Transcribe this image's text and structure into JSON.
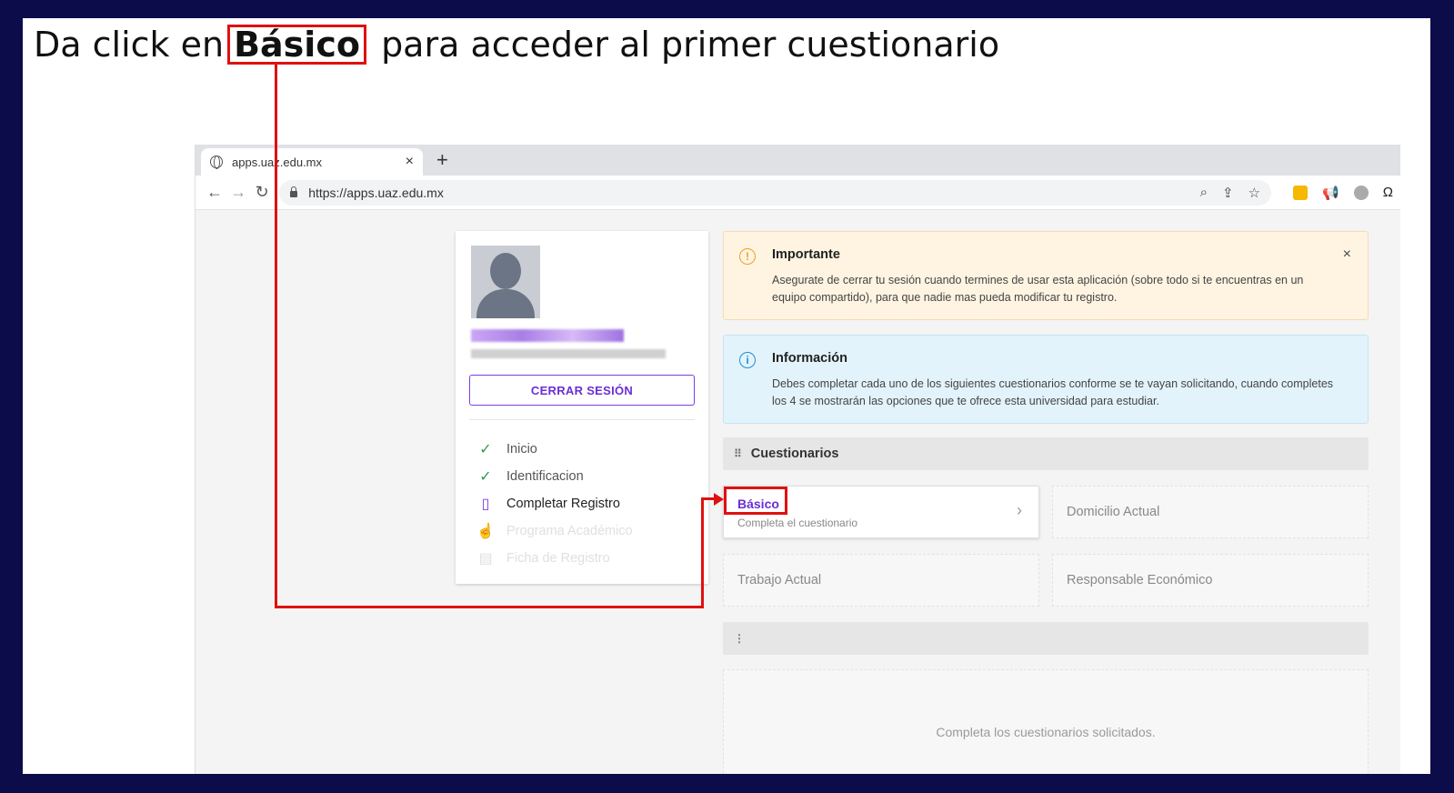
{
  "instruction": {
    "before": "Da click en",
    "highlight": "Básico",
    "after": "para acceder al primer cuestionario"
  },
  "browser": {
    "tab_title": "apps.uaz.edu.mx",
    "tab_close": "×",
    "new_tab": "+",
    "url": "https://apps.uaz.edu.mx",
    "nav": {
      "back": "←",
      "forward": "→",
      "reload": "↻"
    }
  },
  "profile": {
    "logout_label": "CERRAR SESIÓN",
    "steps": [
      {
        "label": "Inicio",
        "icon": "check-icon",
        "state": "done"
      },
      {
        "label": "Identificacion",
        "icon": "check-icon",
        "state": "done"
      },
      {
        "label": "Completar Registro",
        "icon": "book-icon",
        "state": "current"
      },
      {
        "label": "Programa Académico",
        "icon": "hand-icon",
        "state": "disabled"
      },
      {
        "label": "Ficha de Registro",
        "icon": "document-icon",
        "state": "disabled"
      }
    ]
  },
  "alerts": {
    "important": {
      "title": "Importante",
      "text": "Asegurate de cerrar tu sesión cuando termines de usar esta aplicación (sobre todo si te encuentras en un equipo compartido), para que nadie mas pueda modificar tu registro.",
      "close": "×"
    },
    "info": {
      "title": "Información",
      "text": "Debes completar cada uno de los siguientes cuestionarios conforme se te vayan solicitando, cuando completes los 4 se mostrarán las opciones que te ofrece esta universidad para estudiar."
    }
  },
  "questionnaires": {
    "section_title": "Cuestionarios",
    "items": [
      {
        "title": "Básico",
        "subtitle": "Completa el cuestionario",
        "active": true
      },
      {
        "title": "Domicilio Actual",
        "active": false
      },
      {
        "title": "Trabajo Actual",
        "active": false
      },
      {
        "title": "Responsable Económico",
        "active": false
      }
    ]
  },
  "empty_panel": {
    "text": "Completa los cuestionarios solicitados."
  },
  "colors": {
    "frame": "#0c0c4a",
    "highlight": "#e01010",
    "accent": "#6b2ed6",
    "success": "#2e9e4f",
    "warning_bg": "#fff4e2",
    "info_bg": "#e3f3fb"
  }
}
